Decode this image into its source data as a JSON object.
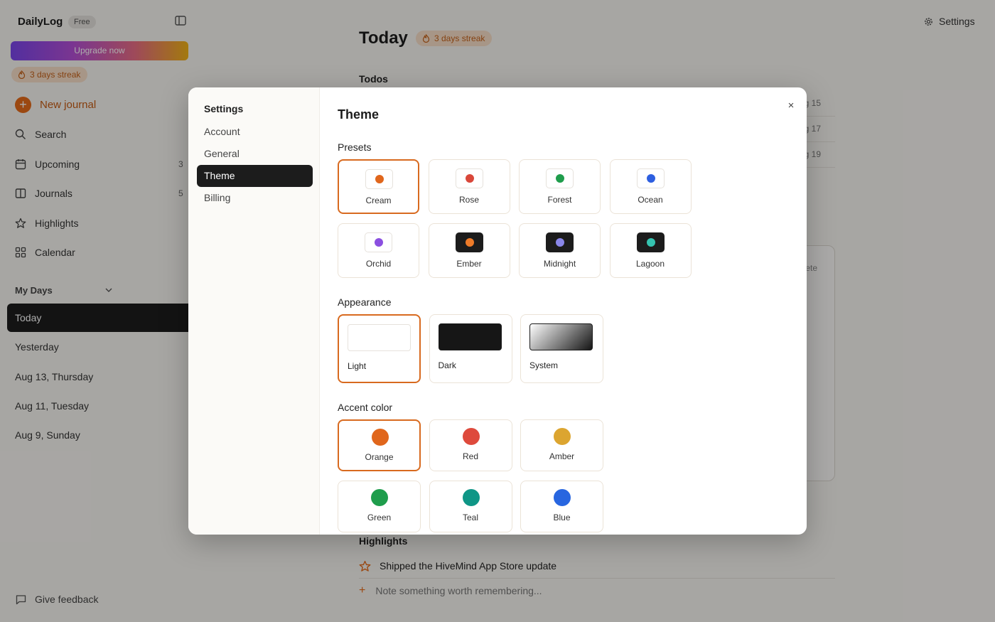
{
  "app": {
    "brand": "DailyLog",
    "plan_badge": "Free",
    "upgrade_label": "Upgrade now",
    "streak_label": "3 days streak"
  },
  "sidebar": {
    "new_journal": "New journal",
    "nav": [
      {
        "label": "Search",
        "icon": "search-icon"
      },
      {
        "label": "Upcoming",
        "icon": "calendar-icon",
        "count": "3"
      },
      {
        "label": "Journals",
        "icon": "book-icon",
        "count": "5"
      },
      {
        "label": "Highlights",
        "icon": "star-icon"
      },
      {
        "label": "Calendar",
        "icon": "grid-icon"
      }
    ],
    "section_title": "My Days",
    "days": [
      "Today",
      "Yesterday",
      "Aug 13, Thursday",
      "Aug 11, Tuesday",
      "Aug 9, Sunday"
    ],
    "feedback": "Give feedback"
  },
  "main": {
    "title": "Today",
    "streak_label": "3 days streak",
    "settings_label": "Settings",
    "todos_title": "Todos",
    "todo_dates": [
      "g 15",
      "g 17",
      "g 19"
    ],
    "card_text": "ete",
    "highlights_title": "Highlights",
    "highlight_item": "Shipped the HiveMind App Store update",
    "note_placeholder": "Note something worth remembering..."
  },
  "settings_modal": {
    "nav_title": "Settings",
    "nav": [
      "Account",
      "General",
      "Theme",
      "Billing"
    ],
    "active_nav": "Theme",
    "close_symbol": "×",
    "content_title": "Theme",
    "presets_label": "Presets",
    "presets": [
      {
        "label": "Cream",
        "dot": "#e0661c",
        "dark": false,
        "selected": true
      },
      {
        "label": "Rose",
        "dot": "#d9473a",
        "dark": false,
        "selected": false
      },
      {
        "label": "Forest",
        "dot": "#1f9d4c",
        "dark": false,
        "selected": false
      },
      {
        "label": "Ocean",
        "dot": "#2d5fe0",
        "dark": false,
        "selected": false
      },
      {
        "label": "Orchid",
        "dot": "#8b4fe0",
        "dark": false,
        "selected": false
      },
      {
        "label": "Ember",
        "dot": "#ee7b29",
        "dark": true,
        "selected": false
      },
      {
        "label": "Midnight",
        "dot": "#8a87ea",
        "dark": true,
        "selected": false
      },
      {
        "label": "Lagoon",
        "dot": "#35c3b0",
        "dark": true,
        "selected": false
      }
    ],
    "appearance_label": "Appearance",
    "appearance": [
      {
        "label": "Light",
        "selected": true
      },
      {
        "label": "Dark",
        "selected": false
      },
      {
        "label": "System",
        "selected": false
      }
    ],
    "accent_label": "Accent color",
    "accents": [
      {
        "label": "Orange",
        "color": "#e0661c",
        "selected": true
      },
      {
        "label": "Red",
        "color": "#de4a3c",
        "selected": false
      },
      {
        "label": "Amber",
        "color": "#dca530",
        "selected": false
      },
      {
        "label": "Green",
        "color": "#1f9d4c",
        "selected": false
      },
      {
        "label": "Teal",
        "color": "#0f9686",
        "selected": false
      },
      {
        "label": "Blue",
        "color": "#2866e0",
        "selected": false
      }
    ]
  }
}
